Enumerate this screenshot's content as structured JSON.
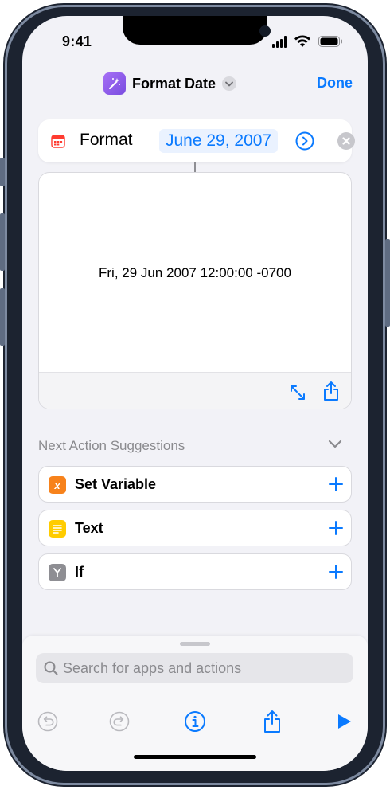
{
  "status_bar": {
    "time": "9:41"
  },
  "navbar": {
    "title": "Format Date",
    "done_label": "Done",
    "app_icon": "magic-wand-icon",
    "accent_color": "#0a7aff",
    "icon_color": "#8e5cf0"
  },
  "action": {
    "verb": "Format",
    "date_value": "June 29, 2007"
  },
  "result": {
    "text": "Fri, 29 Jun 2007 12:00:00 -0700"
  },
  "suggestions": {
    "header": "Next Action Suggestions",
    "items": [
      {
        "label": "Set Variable",
        "icon": "variable-icon",
        "icon_glyph": "x",
        "color": "#f7821b"
      },
      {
        "label": "Text",
        "icon": "text-icon",
        "color": "#ffcc00"
      },
      {
        "label": "If",
        "icon": "if-branch-icon",
        "color": "#8e8e93"
      }
    ]
  },
  "search": {
    "placeholder": "Search for apps and actions",
    "value": ""
  },
  "toolbar": {
    "items": [
      "undo-icon",
      "redo-icon",
      "info-icon",
      "share-icon",
      "play-icon"
    ]
  }
}
